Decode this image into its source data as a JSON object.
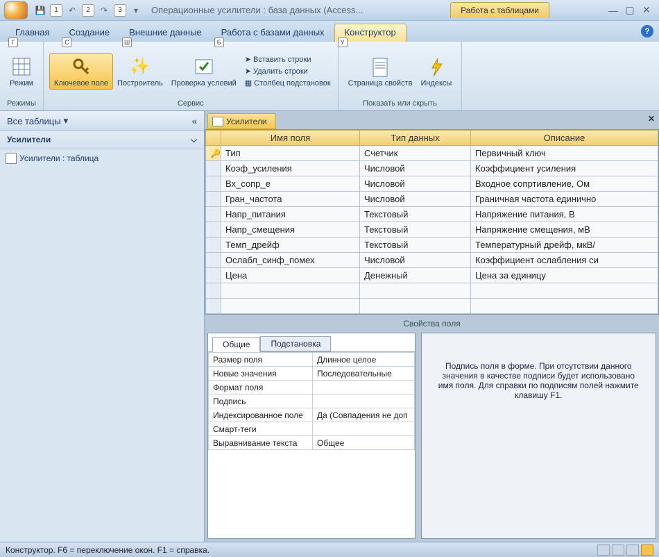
{
  "title": "Операционные усилители : база данных (Access...",
  "contextTab": "Работа с таблицами",
  "qatHints": [
    "1",
    "2",
    "3"
  ],
  "tabs": [
    {
      "label": "Главная",
      "hint": "Г"
    },
    {
      "label": "Создание",
      "hint": "С"
    },
    {
      "label": "Внешние данные",
      "hint": "Ш"
    },
    {
      "label": "Работа с базами данных",
      "hint": "Б"
    },
    {
      "label": "Конструктор",
      "hint": "У",
      "active": true
    }
  ],
  "ribbon": {
    "modes": {
      "label": "Режимы",
      "item": "Режим"
    },
    "tools": {
      "label": "Сервис",
      "key": "Ключевое поле",
      "builder": "Построитель",
      "validate": "Проверка условий",
      "insert": "Вставить строки",
      "delete": "Удалить строки",
      "lookup": "Столбец подстановок"
    },
    "showhide": {
      "label": "Показать или скрыть",
      "props": "Страница свойств",
      "indexes": "Индексы"
    }
  },
  "nav": {
    "header": "Все таблицы",
    "section": "Усилители",
    "item": "Усилители : таблица"
  },
  "designTab": "Усилители",
  "gridHeaders": [
    "Имя поля",
    "Тип данных",
    "Описание"
  ],
  "fields": [
    {
      "pk": true,
      "name": "Тип",
      "type": "Счетчик",
      "desc": "Первичный ключ"
    },
    {
      "name": "Коэф_усиления",
      "type": "Числовой",
      "desc": "Коэффициент усиления"
    },
    {
      "name": "Вх_сопр_е",
      "type": "Числовой",
      "desc": "Входное сопртивление, Ом"
    },
    {
      "name": "Гран_частота",
      "type": "Числовой",
      "desc": "Граничная частота единично"
    },
    {
      "name": "Напр_питания",
      "type": "Текстовый",
      "desc": "Напряжение питания, В"
    },
    {
      "name": "Напр_смещения",
      "type": "Текстовый",
      "desc": "Напряжение смещения, мВ"
    },
    {
      "name": "Темп_дрейф",
      "type": "Текстовый",
      "desc": "Температурный дрейф, мкВ/"
    },
    {
      "name": "Ослабл_синф_помех",
      "type": "Числовой",
      "desc": "Коэффициент ослабления си"
    },
    {
      "name": "Цена",
      "type": "Денежный",
      "desc": "Цена за единицу"
    }
  ],
  "propsLabel": "Свойства поля",
  "propTabs": {
    "general": "Общие",
    "lookup": "Подстановка"
  },
  "properties": [
    {
      "n": "Размер поля",
      "v": "Длинное целое"
    },
    {
      "n": "Новые значения",
      "v": "Последовательные"
    },
    {
      "n": "Формат поля",
      "v": ""
    },
    {
      "n": "Подпись",
      "v": ""
    },
    {
      "n": "Индексированное поле",
      "v": "Да (Совпадения не доп"
    },
    {
      "n": "Смарт-теги",
      "v": ""
    },
    {
      "n": "Выравнивание текста",
      "v": "Общее"
    }
  ],
  "helpText": "Подпись поля в форме. При отсутствии данного значения в качестве подписи будет использовано имя поля. Для справки по подписям полей нажмите клавишу F1.",
  "status": "Конструктор.  F6 = переключение окон.  F1 = справка."
}
